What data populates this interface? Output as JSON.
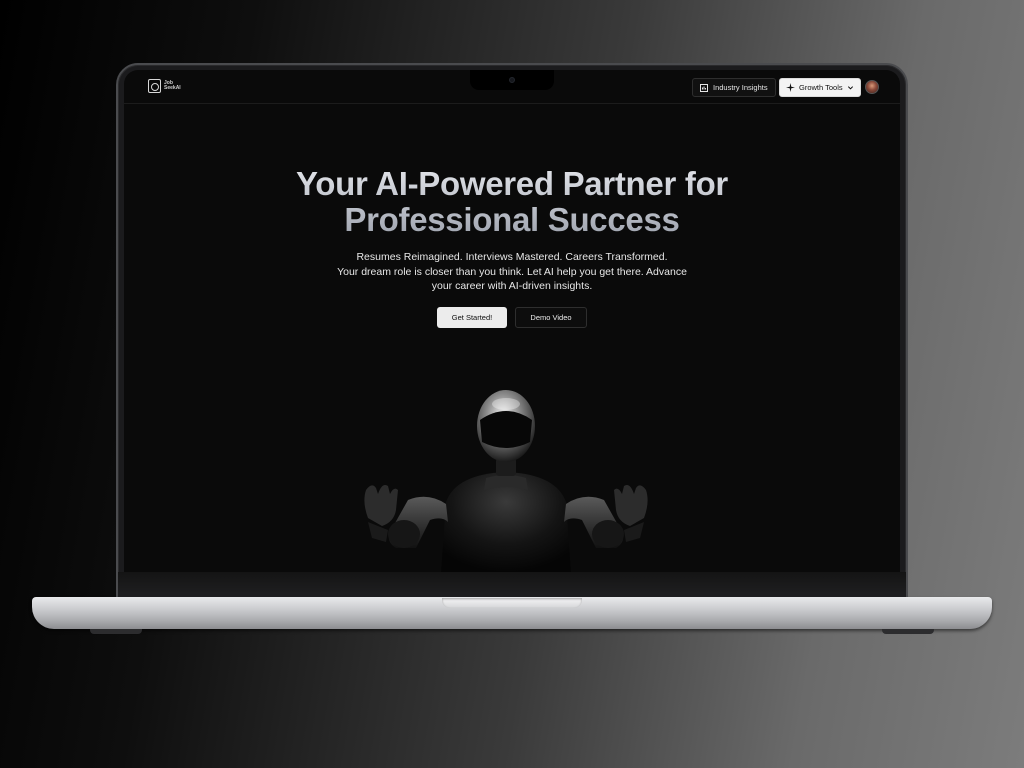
{
  "nav": {
    "logo_line1": "Job",
    "logo_line2": "Seek",
    "logo_line3": "AI",
    "insights_label": "Industry Insights",
    "growth_label": "Growth Tools"
  },
  "hero": {
    "headline_line1": "Your AI-Powered Partner for",
    "headline_line2": "Professional Success",
    "sub_line1": "Resumes Reimagined. Interviews Mastered. Careers Transformed.",
    "sub_line2": "Your dream role is closer than you think. Let AI help you get there. Advance",
    "sub_line3": "your career with AI-driven insights.",
    "primary_cta": "Get Started!",
    "secondary_cta": "Demo Video"
  },
  "icons": {
    "insights": "chart-grid-icon",
    "growth": "sparkle-icon",
    "dropdown": "chevron-down-icon"
  }
}
